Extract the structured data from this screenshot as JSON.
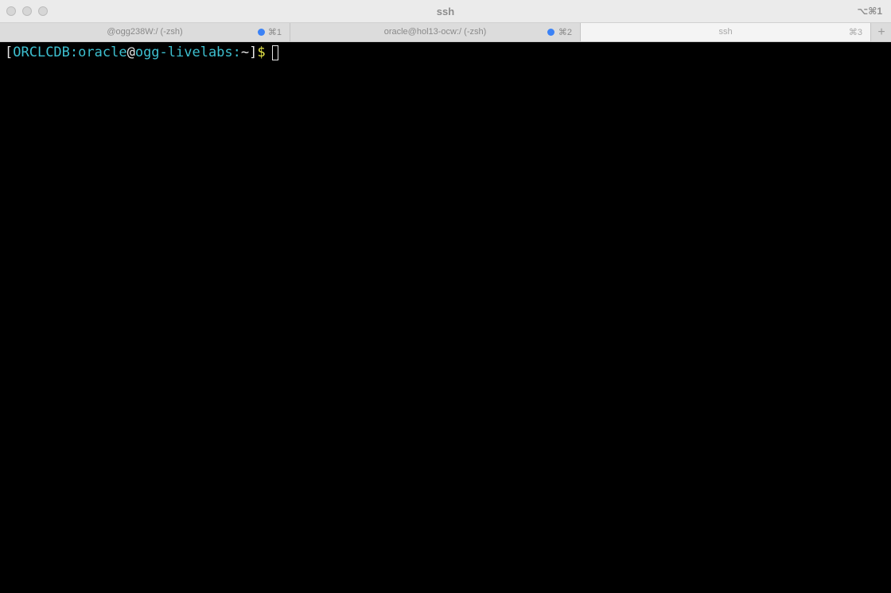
{
  "window": {
    "title": "ssh",
    "title_shortcut": "⌥⌘1"
  },
  "tabs": [
    {
      "label": "@ogg238W:/ (-zsh)",
      "shortcut": "⌘1",
      "has_activity_dot": true,
      "active": false
    },
    {
      "label": "oracle@hol13-ocw:/ (-zsh)",
      "shortcut": "⌘2",
      "has_activity_dot": true,
      "active": false
    },
    {
      "label": "ssh",
      "shortcut": "⌘3",
      "has_activity_dot": false,
      "active": true
    }
  ],
  "new_tab_label": "+",
  "terminal": {
    "prompt": {
      "open_bracket": "[",
      "sid": "ORCLCDB",
      "colon1": ":",
      "user": "oracle",
      "at": "@",
      "host": "ogg-livelabs",
      "colon2": ":",
      "path": "~",
      "close_bracket": "]",
      "symbol": "$"
    }
  },
  "colors": {
    "prompt_cyan": "#3dbfcf",
    "prompt_yellow": "#e8e84a",
    "activity_dot": "#3b82f6",
    "terminal_bg": "#000000"
  }
}
